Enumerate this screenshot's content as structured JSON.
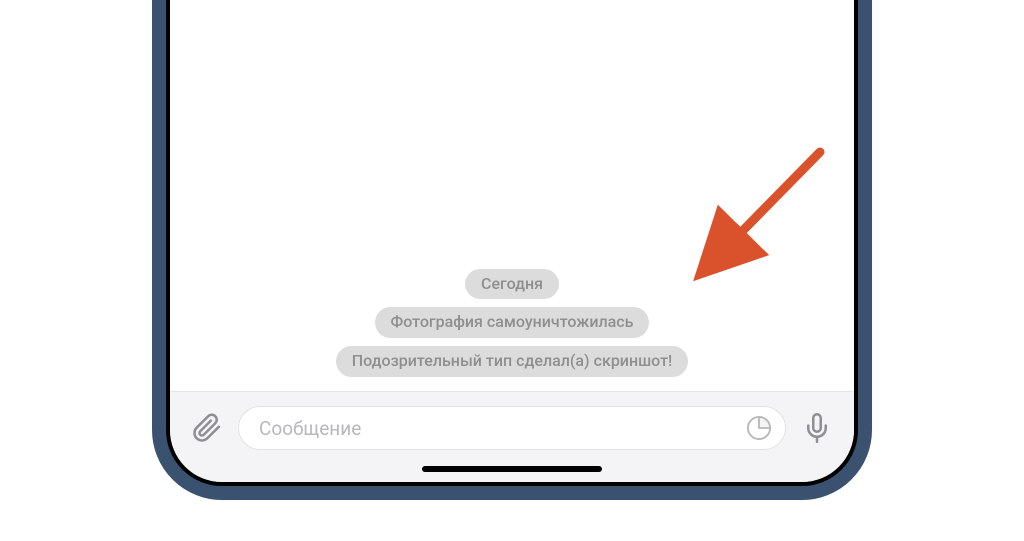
{
  "chat": {
    "date_label": "Сегодня",
    "service_messages": [
      "Фотография самоуничтожилась",
      "Подозрительный тип сделал(а) скриншот!"
    ]
  },
  "input": {
    "placeholder": "Сообщение"
  },
  "annotation": {
    "arrow_color": "#d9522c"
  }
}
